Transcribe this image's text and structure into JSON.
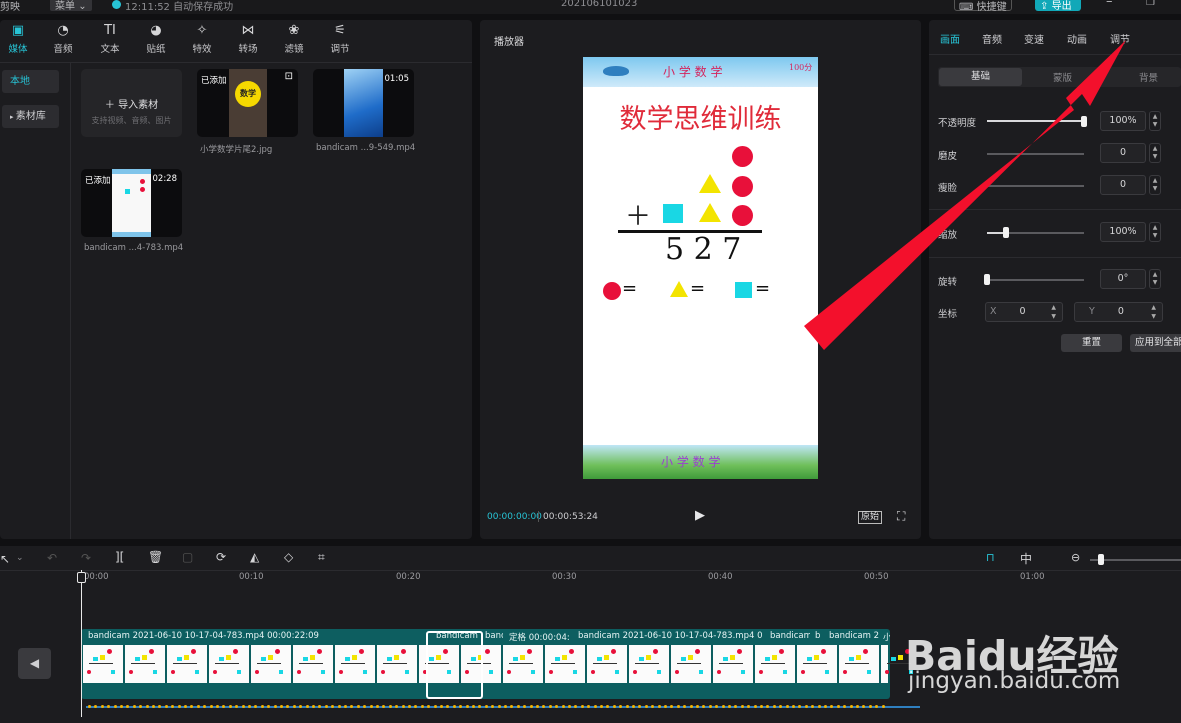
{
  "app": {
    "name": "剪映",
    "menu": "菜单",
    "save_status": "12:11:52 自动保存成功",
    "project_name": "202106101023",
    "shortcuts": "快捷键",
    "export": "导出"
  },
  "toolbar": {
    "items": [
      "媒体",
      "音频",
      "文本",
      "贴纸",
      "特效",
      "转场",
      "滤镜",
      "调节"
    ],
    "text_glyph": "TI"
  },
  "sidebar": {
    "local": "本地",
    "library": "素材库"
  },
  "media": {
    "import_label": "导入素材",
    "import_hint": "支持视频、音频、图片",
    "items": [
      {
        "tag": "已添加",
        "duration": "",
        "name": "小学数学片尾2.jpg"
      },
      {
        "tag": "",
        "duration": "01:05",
        "name": "bandicam ...9-549.mp4"
      },
      {
        "tag": "已添加",
        "duration": "02:28",
        "name": "bandicam ...4-783.mp4"
      }
    ],
    "thumb_word": "数学"
  },
  "player": {
    "title": "播放器",
    "current_time": "00:00:00:00",
    "total_time": "00:00:53:24",
    "ratio_button": "原始",
    "frame": {
      "header": "小 学 数 学",
      "header_score": "100分",
      "heading": "数学思维训练",
      "plus": "＋",
      "result": "5 2 7",
      "equals": "=",
      "footer": "小 学 数 学"
    }
  },
  "inspector": {
    "tabs": [
      "画面",
      "音频",
      "变速",
      "动画",
      "调节"
    ],
    "subtabs": [
      "基础",
      "蒙版",
      "背景"
    ],
    "opacity": {
      "label": "不透明度",
      "value": "100%",
      "level": 1.0
    },
    "denoise": {
      "label": "磨皮",
      "value": "0",
      "level": 0
    },
    "thin": {
      "label": "瘦脸",
      "value": "0",
      "level": 0
    },
    "scale": {
      "label": "缩放",
      "value": "100%",
      "level": 0.2
    },
    "rotate": {
      "label": "旋转",
      "value": "0°",
      "level": 0
    },
    "position": {
      "label": "坐标",
      "x_label": "X",
      "x_value": "0",
      "y_label": "Y",
      "y_value": "0"
    },
    "reset": "重置",
    "apply_all": "应用到全部"
  },
  "timeline": {
    "ticks": [
      "00:00",
      "00:10",
      "00:20",
      "00:30",
      "00:40",
      "00:50",
      "01:00"
    ],
    "clips": [
      {
        "label": "bandicam 2021-06-10 10-17-04-783.mp4   00:00:22:09"
      },
      {
        "label": "bandicam"
      },
      {
        "label": "banc"
      },
      {
        "label": "定格   00:00:04:"
      },
      {
        "label": "bandicam 2021-06-10 10-17-04-783.mp4   0"
      },
      {
        "label": "bandicam"
      },
      {
        "label": "b"
      },
      {
        "label": "bandicam 2"
      },
      {
        "label": "小"
      }
    ]
  },
  "watermark": {
    "brand": "Baidu经验",
    "url": "jingyan.baidu.com"
  },
  "colors": {
    "accent": "#27c4d6",
    "clip": "#0d5e60",
    "export": "#11a8b8",
    "arrow": "#f3102c"
  }
}
